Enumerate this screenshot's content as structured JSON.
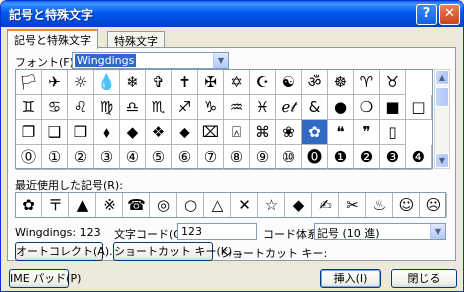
{
  "window": {
    "title": "記号と特殊文字"
  },
  "titlebar": {
    "help_glyph": "?",
    "close_glyph": "✕"
  },
  "tabs": [
    "記号と特殊文字",
    "特殊文字"
  ],
  "font": {
    "label": "フォント(F):",
    "value": "Wingdings"
  },
  "symbols": [
    [
      "🏳",
      "✈",
      "☼",
      "💧",
      "❄",
      "✞",
      "✝",
      "✠",
      "✡",
      "☪",
      "☯",
      "ॐ",
      "☸",
      "♈",
      "♉"
    ],
    [
      "♊",
      "♋",
      "♌",
      "♍",
      "♎",
      "♏",
      "♐",
      "♑",
      "♒",
      "♓",
      "ℯ𝓉",
      "&",
      "●",
      "❍",
      "■",
      "□"
    ],
    [
      "❐",
      "❑",
      "❒",
      "⬧",
      "◆",
      "❖",
      "⬥",
      "⌧",
      "⍓",
      "⌘",
      "❀",
      "✿",
      "❝",
      "❞",
      "▯"
    ],
    [
      "⓪",
      "①",
      "②",
      "③",
      "④",
      "⑤",
      "⑥",
      "⑦",
      "⑧",
      "⑨",
      "⑩",
      "⓿",
      "❶",
      "❷",
      "❸",
      "❹"
    ]
  ],
  "selected_symbol": {
    "row": 2,
    "col": 11
  },
  "recent": {
    "label": "最近使用した記号(R):",
    "items": [
      "✿",
      "〒",
      "▲",
      "※",
      "☎",
      "◎",
      "○",
      "△",
      "✕",
      "☆",
      "◆",
      "✍",
      "✂",
      "♨",
      "☺",
      "☹"
    ]
  },
  "status": {
    "font_code": "Wingdings: 123"
  },
  "char_code": {
    "label": "文字コード(C):",
    "value": "123"
  },
  "code_system": {
    "label": "コード体系(M):",
    "value": "記号 (10 進)"
  },
  "buttons": {
    "autocorrect": "オートコレクト(A)...",
    "shortcut_key": "ショートカット キー(K)...",
    "shortcut_label": "ショートカット キー:",
    "ime_pad": "IME パッド(P)",
    "insert": "挿入(I)",
    "close": "閉じる"
  },
  "icons": {
    "dropdown": "chevron-down-icon",
    "scroll_up": "arrow-up-icon",
    "scroll_down": "arrow-down-icon"
  }
}
